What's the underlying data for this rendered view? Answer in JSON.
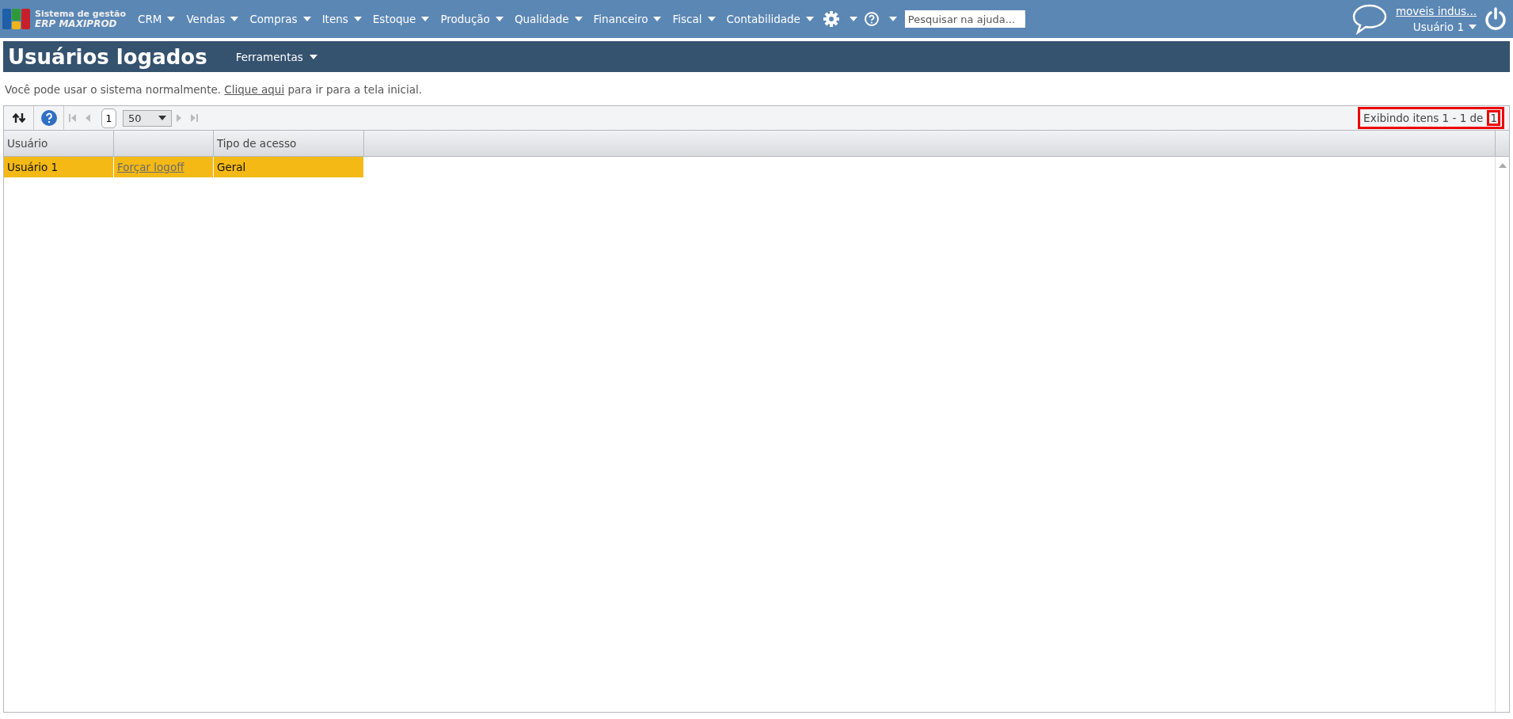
{
  "brand": {
    "line1": "Sistema de gestão",
    "line2": "ERP MAXIPROD"
  },
  "menu": [
    "CRM",
    "Vendas",
    "Compras",
    "Itens",
    "Estoque",
    "Produção",
    "Qualidade",
    "Financeiro",
    "Fiscal",
    "Contabilidade"
  ],
  "search": {
    "placeholder": "Pesquisar na ajuda..."
  },
  "account": {
    "company": "moveis indus...",
    "user": "Usuário 1"
  },
  "page": {
    "title": "Usuários logados",
    "tools": "Ferramentas"
  },
  "message": {
    "before": "Você pode usar o sistema normalmente.",
    "link": "Clique aqui",
    "after": "para ir para a tela inicial."
  },
  "pager": {
    "page": "1",
    "page_size": "50",
    "summary": "Exibindo itens 1 - 1 de",
    "total": "1"
  },
  "table": {
    "columns": [
      "Usuário",
      "",
      "Tipo de acesso"
    ],
    "rows": [
      {
        "user": "Usuário 1",
        "action": "Forçar logoff",
        "access": "Geral",
        "selected": true
      }
    ]
  }
}
